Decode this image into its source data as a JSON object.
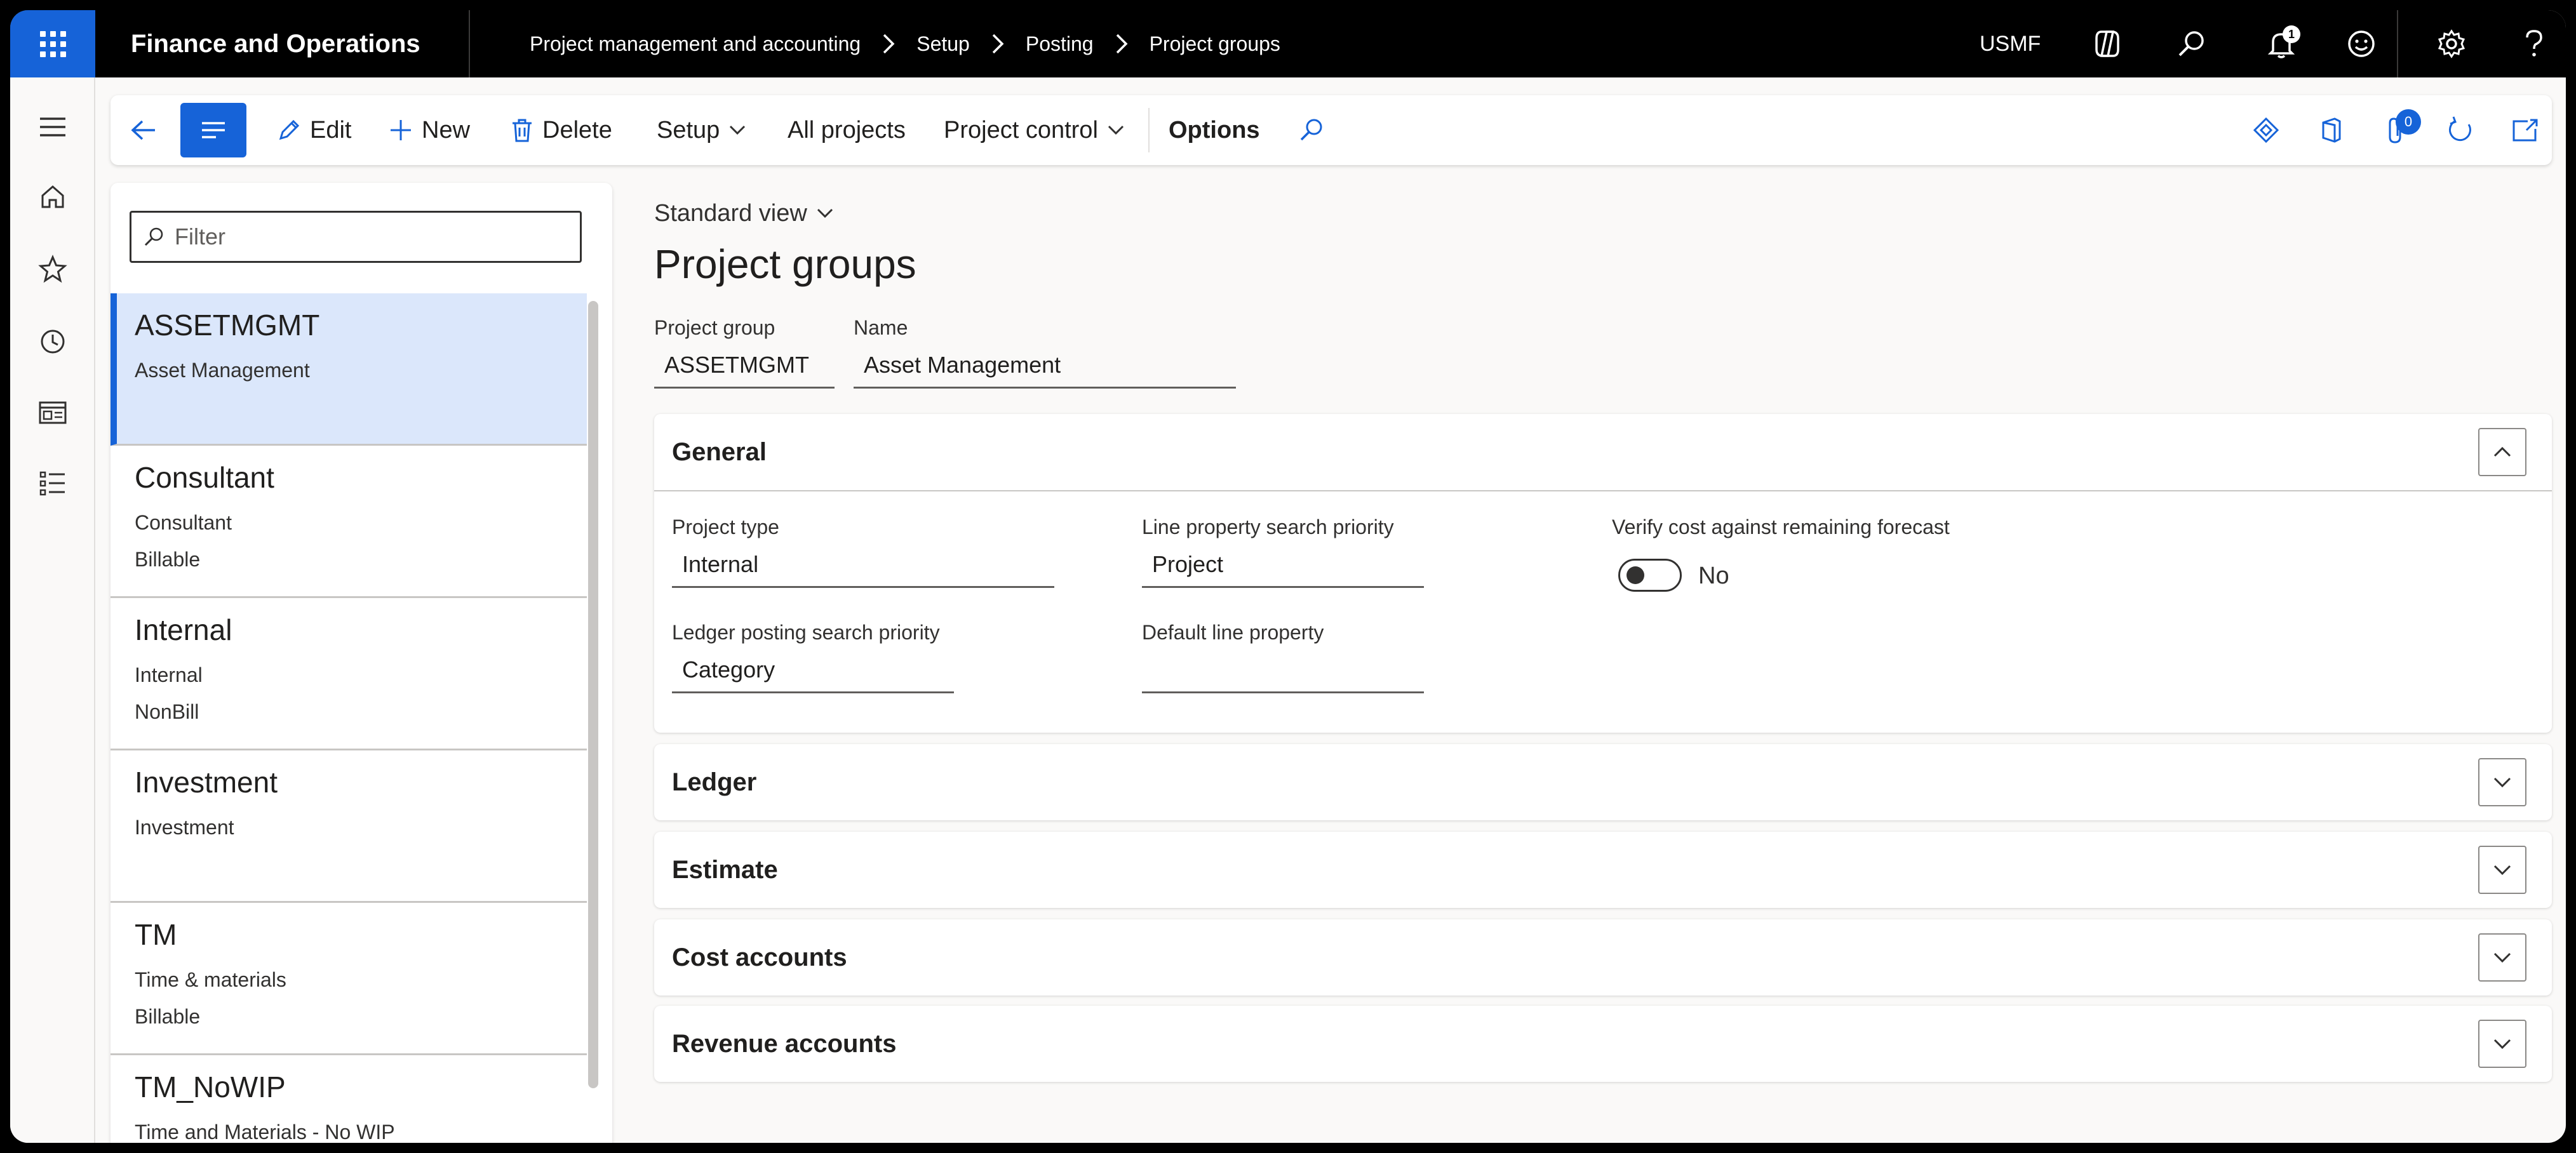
{
  "topbar": {
    "app_title": "Finance and Operations",
    "breadcrumb": [
      "Project management and accounting",
      "Setup",
      "Posting",
      "Project groups"
    ],
    "company": "USMF",
    "notification_count": "1"
  },
  "action_pane": {
    "edit": "Edit",
    "new": "New",
    "delete": "Delete",
    "setup": "Setup",
    "all_projects": "All projects",
    "project_control": "Project control",
    "options": "Options",
    "attachments_count": "0"
  },
  "list": {
    "filter_placeholder": "Filter",
    "items": [
      {
        "title": "ASSETMGMT",
        "lines": [
          "Asset Management"
        ]
      },
      {
        "title": "Consultant",
        "lines": [
          "Consultant",
          "Billable"
        ]
      },
      {
        "title": "Internal",
        "lines": [
          "Internal",
          "NonBill"
        ]
      },
      {
        "title": "Investment",
        "lines": [
          "Investment"
        ]
      },
      {
        "title": "TM",
        "lines": [
          "Time & materials",
          "Billable"
        ]
      },
      {
        "title": "TM_NoWIP",
        "lines": [
          "Time and Materials - No WIP"
        ]
      }
    ]
  },
  "content": {
    "view_name": "Standard view",
    "page_title": "Project groups",
    "header_fields": {
      "project_group_label": "Project group",
      "project_group_value": "ASSETMGMT",
      "name_label": "Name",
      "name_value": "Asset Management"
    },
    "general": {
      "title": "General",
      "project_type_label": "Project type",
      "project_type_value": "Internal",
      "line_property_priority_label": "Line property search priority",
      "line_property_priority_value": "Project",
      "verify_cost_label": "Verify cost against remaining forecast",
      "verify_cost_value": "No",
      "ledger_priority_label": "Ledger posting search priority",
      "ledger_priority_value": "Category",
      "default_line_property_label": "Default line property",
      "default_line_property_value": ""
    },
    "fasttabs": [
      "Ledger",
      "Estimate",
      "Cost accounts",
      "Revenue accounts"
    ]
  },
  "colors": {
    "brand_blue": "#1663d8",
    "selected_row": "#dbe7fb",
    "topbar": "#000000"
  }
}
